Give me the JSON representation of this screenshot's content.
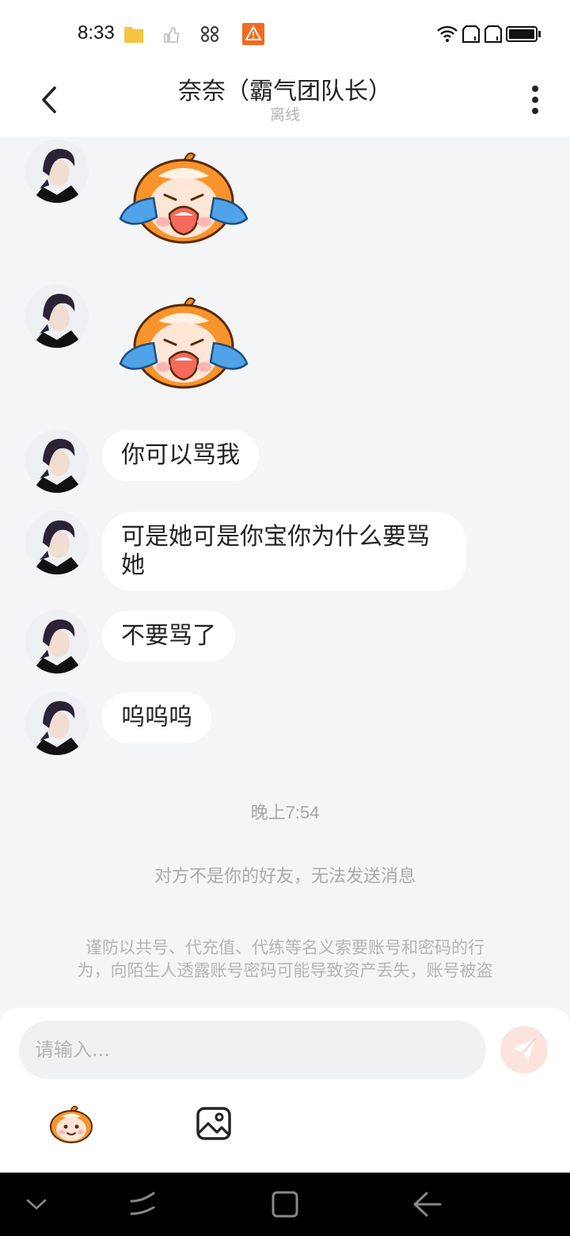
{
  "status_bar": {
    "time": "8:33",
    "icons": [
      "folder-icon",
      "thumb-icon",
      "butterfly-icon",
      "warning-icon",
      "wifi-icon",
      "sim1-icon",
      "sim2-icon",
      "battery-icon"
    ]
  },
  "header": {
    "title": "奈奈（霸气团队长）",
    "subtitle": "离线"
  },
  "messages": [
    {
      "type": "sticker",
      "sticker": "crying-mascot-sticker"
    },
    {
      "type": "sticker",
      "sticker": "crying-mascot-sticker"
    },
    {
      "type": "text",
      "text": "你可以骂我"
    },
    {
      "type": "text",
      "text": "可是她可是你宝你为什么要骂她"
    },
    {
      "type": "text",
      "text": "不要骂了"
    },
    {
      "type": "text",
      "text": "呜呜呜"
    }
  ],
  "timestamp": "晚上7:54",
  "system_notice": "对方不是你的好友，无法发送消息",
  "warning": {
    "line1": "谨防以共号、代充值、代练等名义索要账号和密码的行",
    "line2": "为，向陌生人透露账号密码可能导致资产丢失，账号被盗"
  },
  "input": {
    "placeholder": "请输入..."
  },
  "colors": {
    "accent": "#f26b5b",
    "background": "#f4f5f7",
    "bubble": "#ffffff"
  }
}
